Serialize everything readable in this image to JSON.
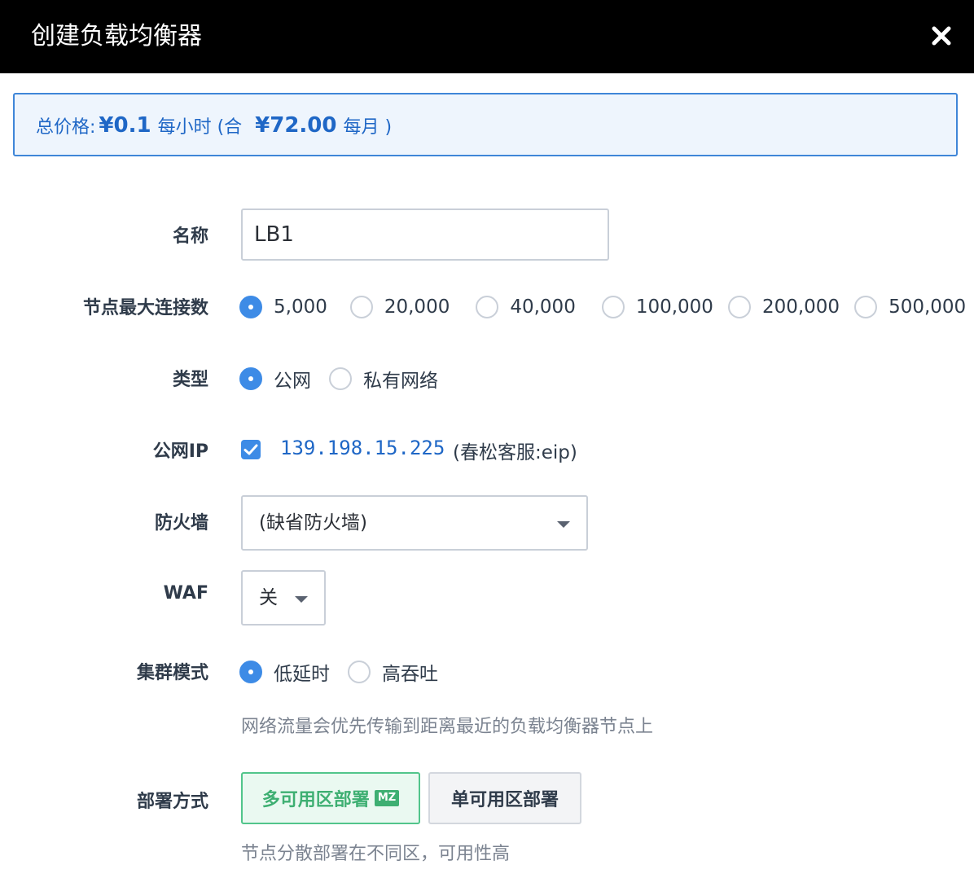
{
  "dialog": {
    "title": "创建负载均衡器"
  },
  "price": {
    "label": "总价格:",
    "hourly": "¥0.1",
    "hourly_unit": "每小时 (合",
    "monthly": "¥72.00",
    "monthly_unit": "每月 )"
  },
  "form": {
    "name": {
      "label": "名称",
      "value": "LB1"
    },
    "max_connections": {
      "label": "节点最大连接数",
      "options": [
        "5,000",
        "20,000",
        "40,000",
        "100,000",
        "200,000",
        "500,000"
      ],
      "selected": "5,000"
    },
    "type": {
      "label": "类型",
      "options": [
        "公网",
        "私有网络"
      ],
      "selected": "公网"
    },
    "public_ip": {
      "label": "公网IP",
      "checked": true,
      "ip": "139.198.15.225",
      "note": "(春松客服:eip)"
    },
    "firewall": {
      "label": "防火墙",
      "value": "(缺省防火墙)"
    },
    "waf": {
      "label": "WAF",
      "value": "关"
    },
    "cluster_mode": {
      "label": "集群模式",
      "options": [
        "低延时",
        "高吞吐"
      ],
      "selected": "低延时",
      "hint": "网络流量会优先传输到距离最近的负载均衡器节点上"
    },
    "deploy": {
      "label": "部署方式",
      "multi_zone": "多可用区部署",
      "multi_zone_badge": "MZ",
      "single_zone": "单可用区部署",
      "hint": "节点分散部署在不同区，可用性高"
    }
  },
  "colors": {
    "accent": "#3d8be6",
    "price_text": "#1f67c6",
    "success": "#3eaf72",
    "titlebar": "#000000"
  },
  "icons": {
    "close": "close-icon",
    "dropdown": "caret-down-icon",
    "check": "check-icon"
  }
}
